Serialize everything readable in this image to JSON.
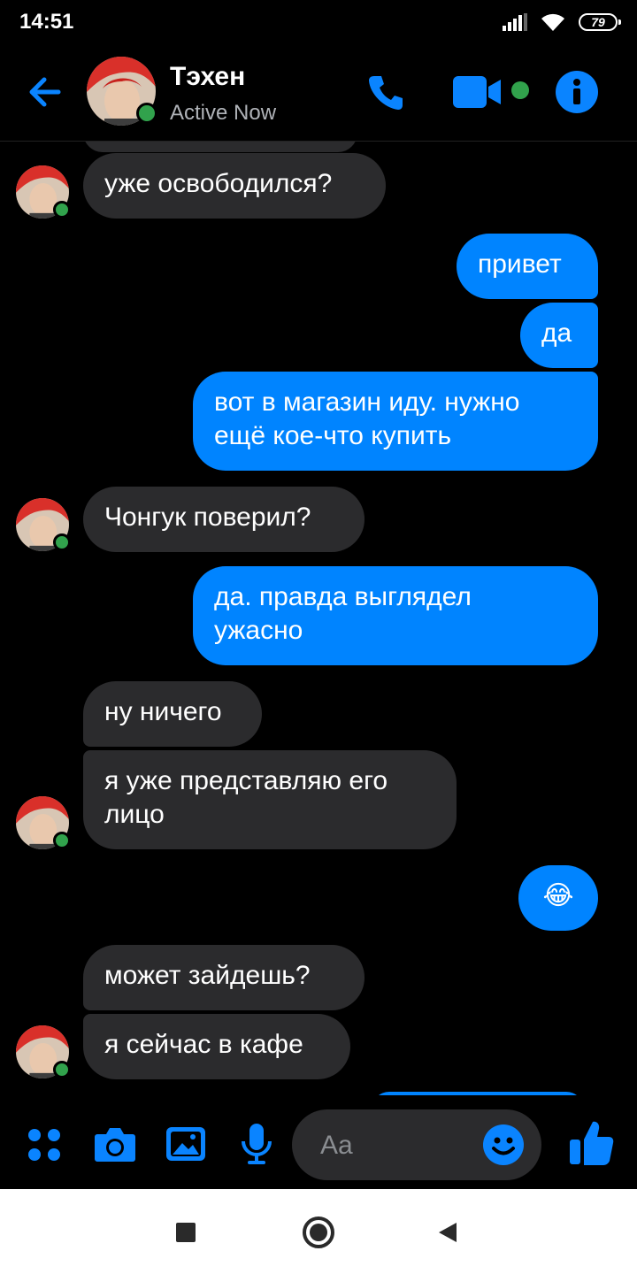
{
  "status_bar": {
    "time": "14:51",
    "battery": "79"
  },
  "header": {
    "name": "Тэхен",
    "status": "Active Now"
  },
  "messages": [
    {
      "side": "in",
      "text": "уже освободился?"
    },
    {
      "side": "out",
      "text": "привет"
    },
    {
      "side": "out",
      "text": "да"
    },
    {
      "side": "out",
      "text": "вот в магазин иду. нужно",
      "text2": "ещё кое-что купить"
    },
    {
      "side": "in",
      "text": "Чонгук поверил?"
    },
    {
      "side": "out",
      "text": "да. правда выглядел",
      "text2": "ужасно"
    },
    {
      "side": "in",
      "text": "ну ничего"
    },
    {
      "side": "in",
      "text": "я уже представляю его",
      "text2": "лицо"
    },
    {
      "side": "out",
      "text": "😂"
    },
    {
      "side": "in",
      "text": "может зайдешь?"
    },
    {
      "side": "in",
      "text": "я сейчас в кафе"
    }
  ],
  "composer": {
    "placeholder": "Aa"
  },
  "colors": {
    "accent": "#0084ff",
    "incoming_bubble": "#2b2b2d",
    "online": "#31a24c"
  },
  "icons": [
    "back-arrow-icon",
    "phone-icon",
    "video-camera-icon",
    "info-icon",
    "apps-icon",
    "camera-icon",
    "gallery-icon",
    "microphone-icon",
    "emoji-icon",
    "thumbs-up-icon",
    "square-icon",
    "circle-home-icon",
    "triangle-back-icon"
  ]
}
